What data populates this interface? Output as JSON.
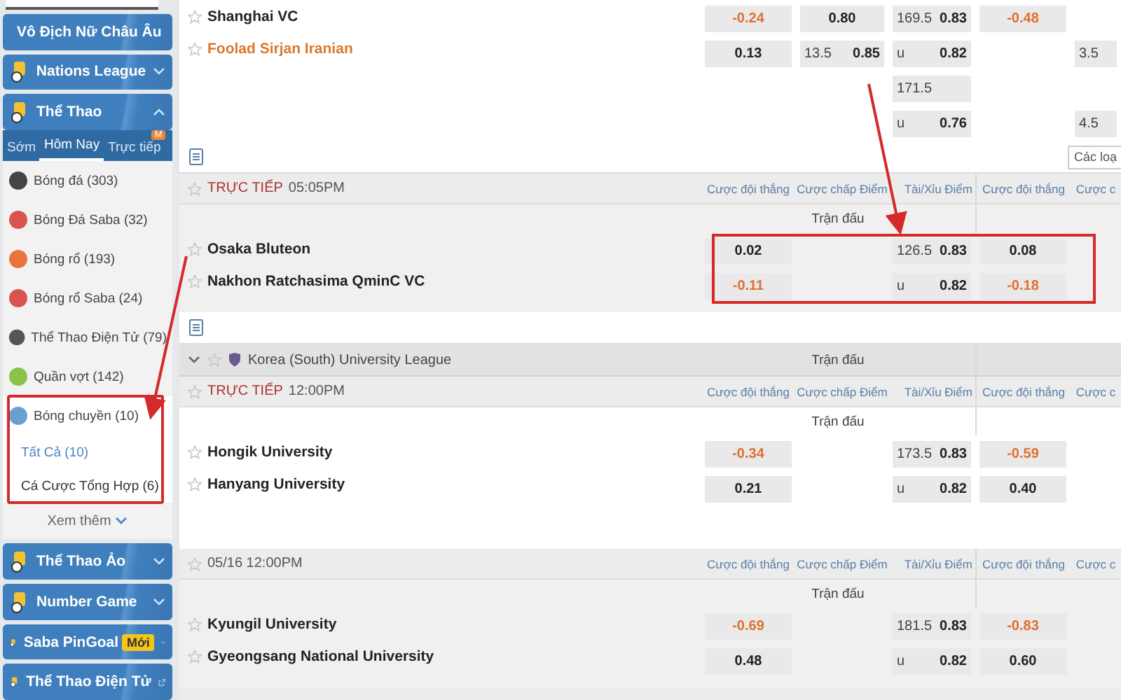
{
  "sidebar": {
    "groups_top": [
      {
        "label": "Vô Địch Nữ Châu Âu",
        "expanded": false
      },
      {
        "label": "Nations League",
        "expanded": false
      }
    ],
    "sports": {
      "label": "Thể Thao",
      "expanded": true,
      "tabs": [
        {
          "label": "Sớm",
          "selected": false
        },
        {
          "label": "Hôm Nay",
          "selected": true
        },
        {
          "label": "Trực tiếp",
          "selected": false,
          "badge": "M"
        }
      ],
      "items": [
        {
          "label": "Bóng đá",
          "count": "(303)",
          "selected": false,
          "color": "#444444"
        },
        {
          "label": "Bóng Đá Saba",
          "count": "(32)",
          "selected": false,
          "color": "#d9534f"
        },
        {
          "label": "Bóng rổ",
          "count": "(193)",
          "selected": false,
          "color": "#e8743b"
        },
        {
          "label": "Bóng rổ Saba",
          "count": "(24)",
          "selected": false,
          "color": "#d9534f"
        },
        {
          "label": "Thể Thao Điện Tử",
          "count": "(79)",
          "selected": false,
          "color": "#555555"
        },
        {
          "label": "Quần vợt",
          "count": "(142)",
          "selected": false,
          "color": "#8bc34a"
        },
        {
          "label": "Bóng chuyền",
          "count": "(10)",
          "selected": true,
          "color": "#6a9fd4",
          "annotated": true,
          "children": [
            {
              "label": "Tất Cả",
              "count": "(10)",
              "selected": true
            },
            {
              "label": "Cá Cược Tổng Hợp",
              "count": "(6)",
              "selected": false
            }
          ]
        }
      ],
      "more": "Xem thêm"
    },
    "groups_bottom": [
      {
        "label": "Thể Thao Ảo",
        "kind": "collapse",
        "expanded": false
      },
      {
        "label": "Number Game",
        "kind": "collapse",
        "expanded": false
      },
      {
        "label": "Saba PinGoal",
        "badge": "Mới",
        "kind": "collapse",
        "expanded": false
      },
      {
        "label": "Thể Thao Điện Tử",
        "kind": "external"
      }
    ]
  },
  "main": {
    "blocks": [
      {
        "kind": "odds-block",
        "teams": [
          {
            "name": "Shanghai VC",
            "highlighted": false
          },
          {
            "name": "Foolad Sirjan Iranian",
            "highlighted": true
          }
        ],
        "rows": [
          [
            {
              "odds": "-0.24",
              "negative": true
            },
            {
              "odds": "0.80",
              "negative": false
            },
            {
              "line": "169.5",
              "odds": "0.83",
              "negative": false
            },
            {
              "odds": "-0.48",
              "negative": true
            },
            null
          ],
          [
            {
              "odds": "0.13",
              "negative": false
            },
            {
              "line": "13.5",
              "odds": "0.85",
              "negative": false
            },
            {
              "line": "u",
              "odds": "0.82",
              "negative": false
            },
            null,
            {
              "line": "3.5"
            }
          ],
          [
            null,
            null,
            {
              "line": "171.5"
            },
            null,
            null
          ],
          [
            null,
            null,
            {
              "line": "u",
              "odds": "0.76",
              "negative": false
            },
            null,
            {
              "line": "4.5"
            }
          ]
        ]
      },
      {
        "kind": "toolbar",
        "button": "Các loạ"
      },
      {
        "kind": "event",
        "status": "TRỰC TIẾP",
        "time": "05:05PM",
        "headers": [
          "Cược đội thắng",
          "Cược chấp Điểm",
          "Tài/Xỉu Điểm",
          "Cược đội thắng",
          "Cược c"
        ],
        "market": "Trận đấu",
        "annotated": true,
        "teams": [
          {
            "name": "Osaka Bluteon"
          },
          {
            "name": "Nakhon Ratchasima QminC VC"
          }
        ],
        "rows": [
          [
            {
              "odds": "0.02",
              "negative": false
            },
            null,
            {
              "line": "126.5",
              "odds": "0.83",
              "negative": false
            },
            {
              "odds": "0.08",
              "negative": false
            },
            null
          ],
          [
            {
              "odds": "-0.11",
              "negative": true
            },
            null,
            {
              "line": "u",
              "odds": "0.82",
              "negative": false
            },
            {
              "odds": "-0.18",
              "negative": true
            },
            null
          ]
        ]
      },
      {
        "kind": "toolbar"
      },
      {
        "kind": "league",
        "name": "Korea (South) University League",
        "market": "Trận đấu",
        "expanded": true
      },
      {
        "kind": "event",
        "status": "TRỰC TIẾP",
        "time": "12:00PM",
        "headers": [
          "Cược đội thắng",
          "Cược chấp Điểm",
          "Tài/Xỉu Điểm",
          "Cược đội thắng",
          "Cược c"
        ],
        "market": "Trận đấu",
        "annotated": false,
        "teams": [
          {
            "name": "Hongik University"
          },
          {
            "name": "Hanyang University"
          }
        ],
        "rows": [
          [
            {
              "odds": "-0.34",
              "negative": true
            },
            null,
            {
              "line": "173.5",
              "odds": "0.83",
              "negative": false
            },
            {
              "odds": "-0.59",
              "negative": true
            },
            null
          ],
          [
            {
              "odds": "0.21",
              "negative": false
            },
            null,
            {
              "line": "u",
              "odds": "0.82",
              "negative": false
            },
            {
              "odds": "0.40",
              "negative": false
            },
            null
          ]
        ]
      },
      {
        "kind": "event",
        "time": "05/16 12:00PM",
        "headers": [
          "Cược đội thắng",
          "Cược chấp Điểm",
          "Tài/Xỉu Điểm",
          "Cược đội thắng",
          "Cược c"
        ],
        "market": "Trận đấu",
        "annotated": false,
        "teams": [
          {
            "name": "Kyungil University"
          },
          {
            "name": "Gyeongsang National University"
          }
        ],
        "rows": [
          [
            {
              "odds": "-0.69",
              "negative": true
            },
            null,
            {
              "line": "181.5",
              "odds": "0.83",
              "negative": false
            },
            {
              "odds": "-0.83",
              "negative": true
            },
            null
          ],
          [
            {
              "odds": "0.48",
              "negative": false
            },
            null,
            {
              "line": "u",
              "odds": "0.82",
              "negative": false
            },
            {
              "odds": "0.60",
              "negative": false
            },
            null
          ]
        ]
      }
    ]
  }
}
